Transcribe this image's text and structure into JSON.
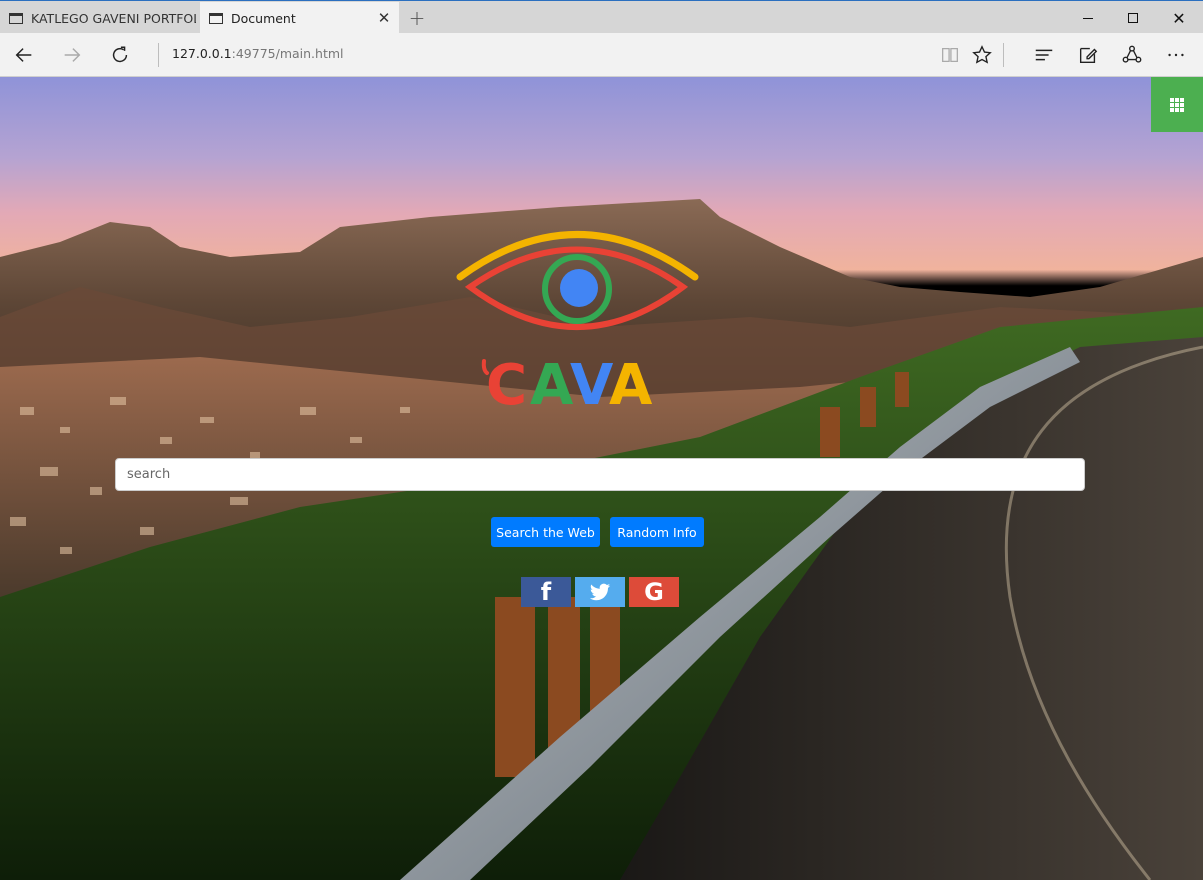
{
  "browser": {
    "tabs": [
      {
        "title": "KATLEGO GAVENI PORTFOLI",
        "active": false
      },
      {
        "title": "Document",
        "active": true
      }
    ],
    "address": {
      "host": "127.0.0.1",
      "rest": ":49775/main.html"
    },
    "new_tab_glyph": "+",
    "close_tab_glyph": "✕",
    "window_close_glyph": "✕"
  },
  "page": {
    "logo_text": "CAVA",
    "logo_colors": {
      "yellow": "#f4b400",
      "red": "#e94235",
      "green": "#34a853",
      "blue": "#4285f4"
    },
    "search": {
      "placeholder": "search",
      "value": ""
    },
    "buttons": {
      "search_web": "Search the Web",
      "random_info": "Random Info"
    },
    "social": {
      "facebook": "f",
      "google": "G"
    },
    "accent_colors": {
      "apps": "#4caf50",
      "button": "#007bff",
      "facebook": "#3b5998",
      "twitter": "#55acee",
      "google": "#dd4b39"
    }
  }
}
